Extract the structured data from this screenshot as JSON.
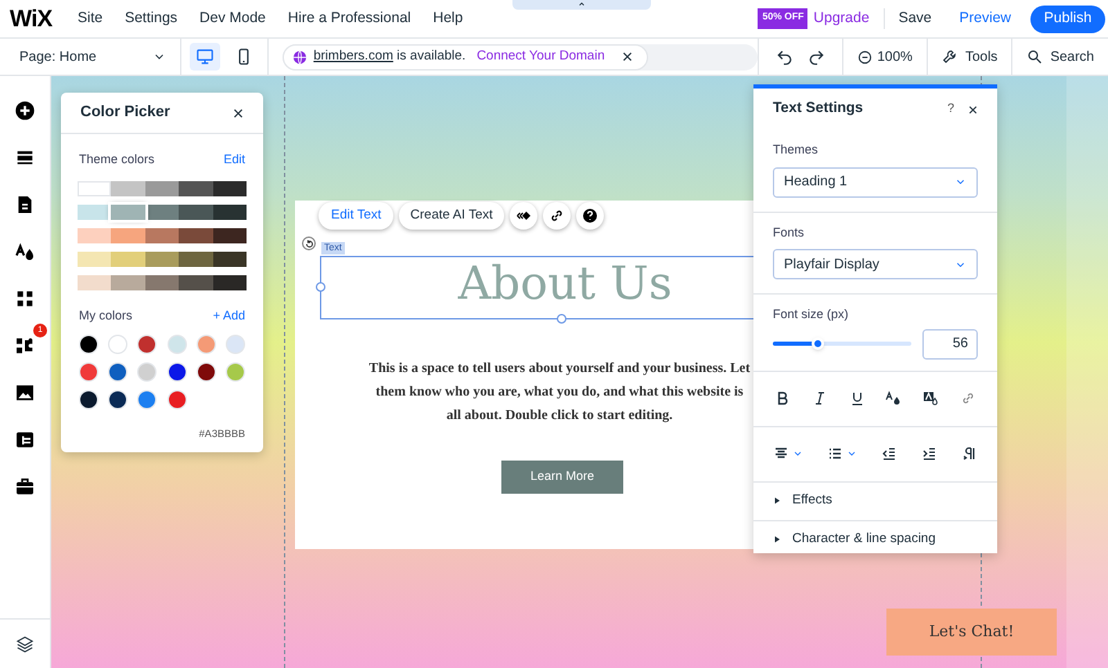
{
  "top_bar": {
    "logo": "WiX",
    "menu": [
      "Site",
      "Settings",
      "Dev Mode",
      "Hire a Professional",
      "Help"
    ],
    "promo_badge": "50% OFF",
    "upgrade": "Upgrade",
    "save": "Save",
    "preview": "Preview",
    "publish": "Publish"
  },
  "toolbar": {
    "page": "Page: Home",
    "devices": [
      {
        "kind": "desktop",
        "selected": true
      },
      {
        "kind": "mobile",
        "selected": false
      }
    ],
    "domain": "brimbers.com",
    "domain_text": "is available.",
    "connect": "Connect Your Domain",
    "zoom": "100%",
    "tools": "Tools",
    "search": "Search"
  },
  "left_sidebar": {
    "items": [
      {
        "kind": "add"
      },
      {
        "kind": "sections"
      },
      {
        "kind": "pages"
      },
      {
        "kind": "design"
      },
      {
        "kind": "apps"
      },
      {
        "kind": "business",
        "badge": "1"
      },
      {
        "kind": "media"
      },
      {
        "kind": "table"
      },
      {
        "kind": "portfolio"
      }
    ]
  },
  "color_picker": {
    "title": "Color Picker",
    "theme_label": "Theme colors",
    "edit": "Edit",
    "theme_rows": [
      {
        "swatches": [
          {
            "color": "#ffffff",
            "selected": false
          },
          {
            "color": "#c4c4c4",
            "selected": false
          },
          {
            "color": "#9a9a9a",
            "selected": false
          },
          {
            "color": "#555555",
            "selected": false
          },
          {
            "color": "#2b2b2b",
            "selected": false
          }
        ]
      },
      {
        "swatches": [
          {
            "color": "#c8e4ea",
            "selected": false
          },
          {
            "color": "#9fb4b4",
            "selected": true
          },
          {
            "color": "#6e8080",
            "selected": false
          },
          {
            "color": "#4a5757",
            "selected": false
          },
          {
            "color": "#283232",
            "selected": false
          }
        ]
      },
      {
        "swatches": [
          {
            "color": "#fdd0be",
            "selected": false
          },
          {
            "color": "#f6a57e",
            "selected": false
          },
          {
            "color": "#b87860",
            "selected": false
          },
          {
            "color": "#7a4a3a",
            "selected": false
          },
          {
            "color": "#3d2620",
            "selected": false
          }
        ]
      },
      {
        "swatches": [
          {
            "color": "#f4e6b2",
            "selected": false
          },
          {
            "color": "#e2cf7a",
            "selected": false
          },
          {
            "color": "#a99c5c",
            "selected": false
          },
          {
            "color": "#6e6640",
            "selected": false
          },
          {
            "color": "#3a3526",
            "selected": false
          }
        ]
      },
      {
        "swatches": [
          {
            "color": "#f2dccc",
            "selected": false
          },
          {
            "color": "#b8aa9c",
            "selected": false
          },
          {
            "color": "#86786e",
            "selected": false
          },
          {
            "color": "#55504a",
            "selected": false
          },
          {
            "color": "#2a2826",
            "selected": false
          }
        ]
      }
    ],
    "my_colors_label": "My colors",
    "add": "+ Add",
    "my_colors": [
      {
        "color": "#000000"
      },
      {
        "color": "#ffffff"
      },
      {
        "color": "#c0302e"
      },
      {
        "color": "#cfe5ea"
      },
      {
        "color": "#f49a76"
      },
      {
        "color": "#dbe6f6"
      },
      {
        "color": "#f03a3a"
      },
      {
        "color": "#0f5fbf"
      },
      {
        "color": "#d0d0d0"
      },
      {
        "color": "#0b18e8"
      },
      {
        "color": "#7f0a0a"
      },
      {
        "color": "#a6c94a"
      },
      {
        "color": "#0b1a2e"
      },
      {
        "color": "#0a2a55"
      },
      {
        "color": "#1c7ff0"
      },
      {
        "color": "#e81e22"
      }
    ],
    "hex": "#A3BBBB"
  },
  "canvas": {
    "floating_toolbar": {
      "edit_text": "Edit Text",
      "create_ai": "Create AI Text"
    },
    "element_tag": "Text",
    "heading": "About Us",
    "body": "This is a space to tell users about yourself and your business. Let them know who you are, what you do, and what this website is all about. Double click to start editing.",
    "button": "Learn More",
    "chat_button": "Let's Chat!"
  },
  "text_settings": {
    "title": "Text Settings",
    "help": "?",
    "themes_label": "Themes",
    "theme": "Heading 1",
    "fonts_label": "Fonts",
    "font": "Playfair Display",
    "size_label": "Font size (px)",
    "size_slider": {
      "level": 0.32
    },
    "size_value": "56",
    "sections": [
      "Effects",
      "Character & line spacing"
    ]
  }
}
